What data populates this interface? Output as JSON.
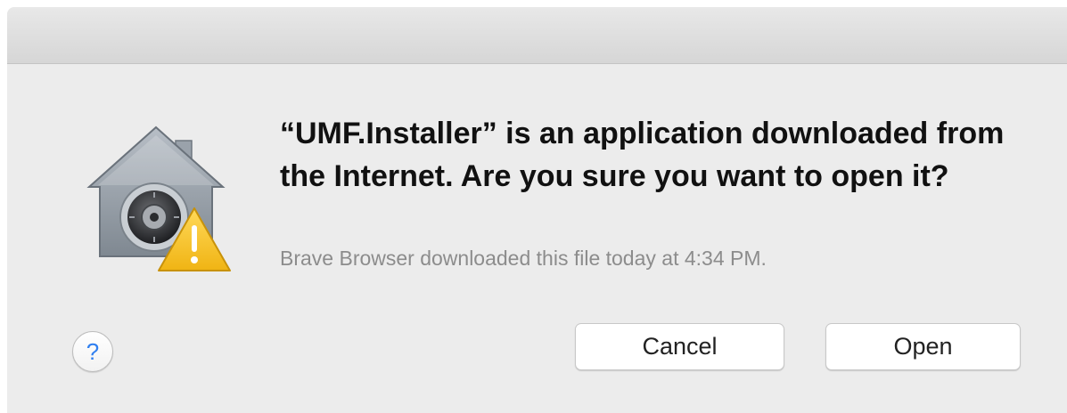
{
  "dialog": {
    "message": "“UMF.Installer” is an application downloaded from the Internet. Are you sure you want to open it?",
    "info": "Brave Browser downloaded this file today at 4:34 PM.",
    "help_label": "?",
    "cancel_label": "Cancel",
    "open_label": "Open",
    "icon": "gatekeeper-warning-icon"
  },
  "colors": {
    "background": "#ececec",
    "help_accent": "#2f7ff0",
    "warning_yellow": "#f6c62a"
  }
}
